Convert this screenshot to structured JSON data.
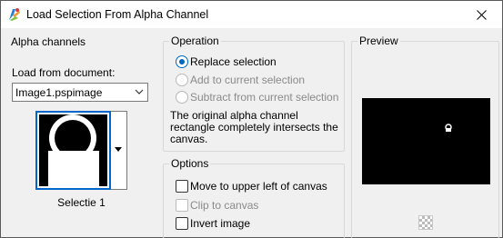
{
  "window": {
    "title": "Load Selection From Alpha Channel"
  },
  "alpha_channels": {
    "group_label": "Alpha channels",
    "load_from_label": "Load from document:",
    "document": "Image1.pspimage",
    "selected_channel": "Selectie 1"
  },
  "operation": {
    "group_label": "Operation",
    "options": [
      {
        "label": "Replace selection",
        "checked": true,
        "enabled": true
      },
      {
        "label": "Add to current selection",
        "checked": false,
        "enabled": false
      },
      {
        "label": "Subtract from current selection",
        "checked": false,
        "enabled": false
      }
    ],
    "note": "The original alpha channel rectangle completely intersects the canvas."
  },
  "options": {
    "group_label": "Options",
    "items": [
      {
        "label": "Move to upper left of canvas",
        "checked": false,
        "enabled": true
      },
      {
        "label": "Clip to canvas",
        "checked": false,
        "enabled": false
      },
      {
        "label": "Invert image",
        "checked": false,
        "enabled": true
      }
    ]
  },
  "preview": {
    "group_label": "Preview"
  },
  "icons": {
    "app": "psp-app-icon",
    "close": "close-icon",
    "dropdown": "chevron-down-icon",
    "thumb_dropdown": "triangle-down-icon",
    "transparency": "checkerboard-icon"
  },
  "colors": {
    "accent": "#0067c0",
    "selection_border": "#0066cc",
    "preview_bg": "#000000"
  }
}
